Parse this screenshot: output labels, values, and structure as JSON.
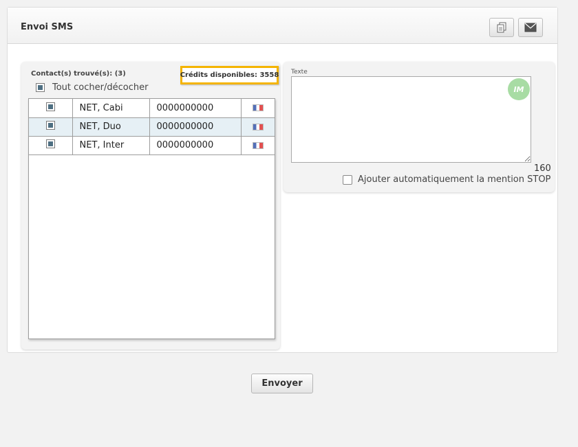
{
  "panel": {
    "title": "Envoi SMS"
  },
  "header_buttons": {
    "copy_icon": "document-copy-icon",
    "mail_icon": "envelope-icon"
  },
  "contacts": {
    "found_label": "Contact(s) trouvé(s): (3)",
    "credits_label": "Crédits disponibles: 3558",
    "toggle_all_label": "Tout cocher/décocher",
    "rows": [
      {
        "name": "NET, Cabi",
        "phone": "0000000000",
        "checked": true,
        "flag": "france-flag-icon"
      },
      {
        "name": "NET, Duo",
        "phone": "0000000000",
        "checked": true,
        "flag": "france-flag-icon"
      },
      {
        "name": "NET, Inter",
        "phone": "0000000000",
        "checked": true,
        "flag": "france-flag-icon"
      }
    ]
  },
  "message": {
    "label": "Texte",
    "value": "",
    "avatar_text": "IM",
    "char_count": "160",
    "stop_option_label": "Ajouter automatiquement la mention STOP",
    "stop_checked": false
  },
  "send_label": "Envoyer",
  "colors": {
    "highlight_border": "#f4b400",
    "selected_row": "#e6f0f5",
    "checkbox_fill": "#4e6f82",
    "avatar_bg": "#a8dca4"
  }
}
